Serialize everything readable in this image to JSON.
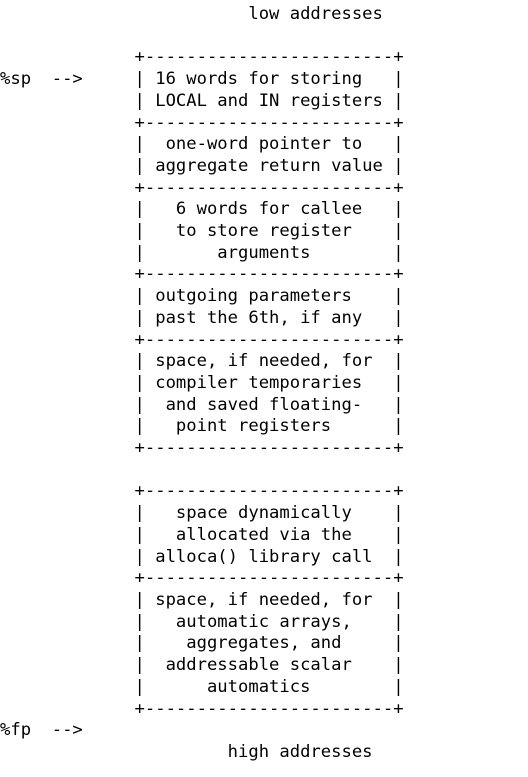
{
  "diagram": {
    "title_top": "low addresses",
    "title_bottom": "high addresses",
    "pointer_top": "%sp  -->",
    "pointer_bottom": "%fp  -->",
    "box_width_chars": 26,
    "left_margin_chars": 13,
    "colors": {
      "text": "#000000",
      "background": "#ffffff"
    },
    "borders": {
      "horizontal_rule": "+------------------------+",
      "corner_char": "+",
      "horizontal_char": "-",
      "vertical_char": "|"
    },
    "sections": [
      {
        "id": "local-in-registers",
        "lines": [
          "16 words for storing",
          "LOCAL and IN registers"
        ],
        "align": "left"
      },
      {
        "id": "aggregate-return-pointer",
        "lines": [
          "one-word pointer to",
          "aggregate return value"
        ],
        "align": "center"
      },
      {
        "id": "callee-register-arguments",
        "lines": [
          "6 words for callee",
          "to store register",
          "arguments"
        ],
        "align": "center"
      },
      {
        "id": "outgoing-parameters",
        "lines": [
          "outgoing parameters",
          "past the 6th, if any"
        ],
        "align": "center"
      },
      {
        "id": "compiler-temporaries",
        "lines": [
          "space, if needed, for",
          "compiler temporaries",
          "and saved floating-",
          "point registers"
        ],
        "align": "center"
      },
      {
        "id": "alloca-dynamic-space",
        "lines": [
          "space dynamically",
          "allocated via the",
          "alloca() library call"
        ],
        "align": "center",
        "gap_before": true
      },
      {
        "id": "automatic-storage",
        "lines": [
          "space, if needed, for",
          "automatic arrays,",
          "aggregates, and",
          "addressable scalar",
          "automatics"
        ],
        "align": "center"
      }
    ],
    "ascii": "                        low addresses\n\n             +------------------------+\n%sp  -->     | 16 words for storing   |\n             | LOCAL and IN registers |\n             +------------------------+\n             |  one-word pointer to   |\n             | aggregate return value |\n             +------------------------+\n             |   6 words for callee   |\n             |   to store register    |\n             |       arguments        |\n             +------------------------+\n             | outgoing parameters    |\n             | past the 6th, if any   |\n             +------------------------+\n             | space, if needed, for  |\n             | compiler temporaries   |\n             |  and saved floating-   |\n             |   point registers      |\n             +------------------------+\n\n             +------------------------+\n             |   space dynamically    |\n             |   allocated via the    |\n             | alloca() library call  |\n             +------------------------+\n             | space, if needed, for  |\n             |   automatic arrays,    |\n             |    aggregates, and     |\n             |  addressable scalar    |\n             |      automatics        |\n             +------------------------+\n%fp  -->\n                      high addresses"
  }
}
